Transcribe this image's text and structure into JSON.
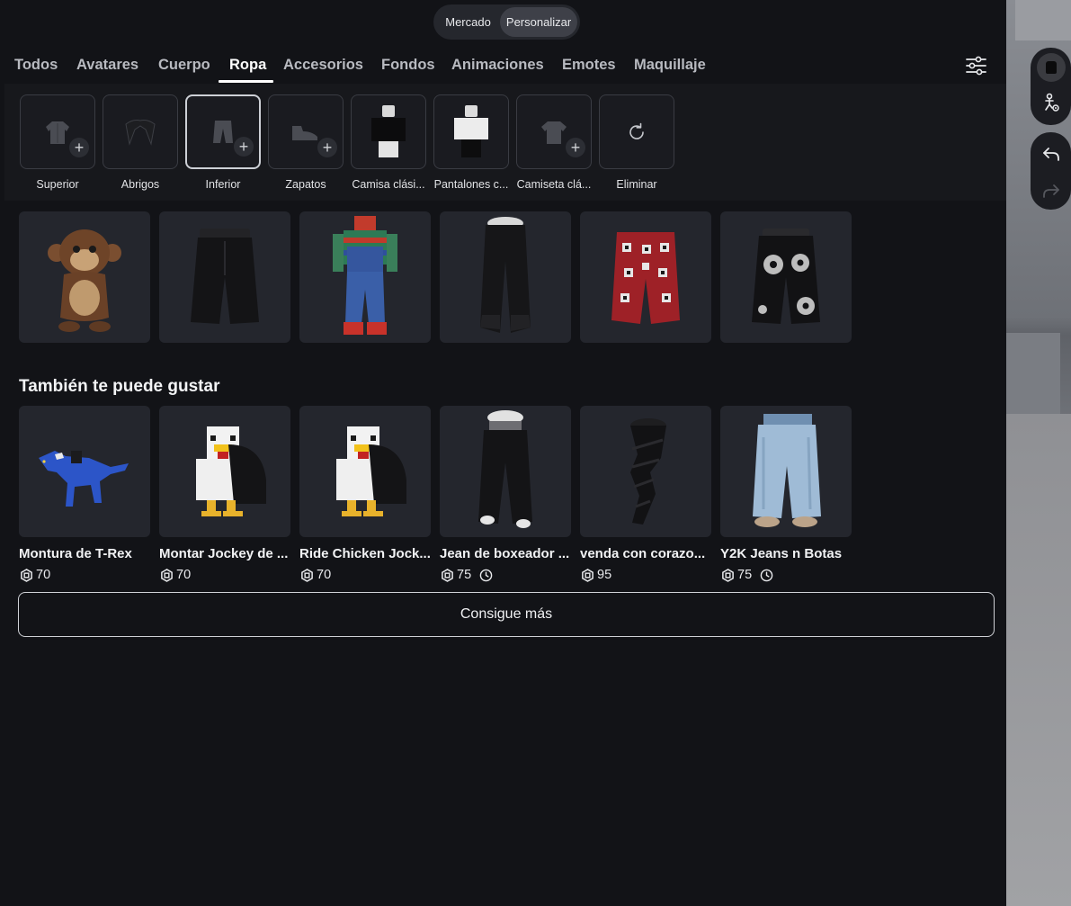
{
  "segmented": {
    "market": "Mercado",
    "customize": "Personalizar"
  },
  "tabs": [
    "Todos",
    "Avatares",
    "Cuerpo",
    "Ropa",
    "Accesorios",
    "Fondos",
    "Animaciones",
    "Emotes",
    "Maquillaje"
  ],
  "active_tab": "Ropa",
  "slots": [
    {
      "label": "Superior",
      "icon": "shirt-icon",
      "empty": true
    },
    {
      "label": "Abrigos",
      "icon": "jacket-icon",
      "empty": false
    },
    {
      "label": "Inferior",
      "icon": "pants-icon",
      "empty": true,
      "selected": true
    },
    {
      "label": "Zapatos",
      "icon": "shoe-icon",
      "empty": true
    },
    {
      "label": "Camisa clási...",
      "icon": "classic-shirt-thumbnail",
      "empty": false
    },
    {
      "label": "Pantalones c...",
      "icon": "classic-pants-thumbnail",
      "empty": false
    },
    {
      "label": "Camiseta clá...",
      "icon": "tshirt-icon",
      "empty": true
    },
    {
      "label": "Eliminar",
      "icon": "reset-icon",
      "empty": false
    }
  ],
  "owned_items": [
    {
      "thumbnail": "monkey-costume"
    },
    {
      "thumbnail": "black-shorts"
    },
    {
      "thumbnail": "doll-overalls"
    },
    {
      "thumbnail": "black-baggy-pants"
    },
    {
      "thumbnail": "red-pattern-shorts"
    },
    {
      "thumbnail": "black-floral-shorts"
    }
  ],
  "recommendations": {
    "title": "También te puede gustar",
    "items": [
      {
        "name": "Montura de T-Rex",
        "price": "70",
        "limited": false,
        "thumbnail": "blue-trex"
      },
      {
        "name": "Montar Jockey de ...",
        "price": "70",
        "limited": false,
        "thumbnail": "chicken-jockey"
      },
      {
        "name": "Ride Chicken Jock...",
        "price": "70",
        "limited": false,
        "thumbnail": "chicken-jockey"
      },
      {
        "name": "Jean de boxeador ...",
        "price": "75",
        "limited": true,
        "thumbnail": "boxer-jeans"
      },
      {
        "name": "venda con corazo...",
        "price": "95",
        "limited": false,
        "thumbnail": "black-wrap-leg"
      },
      {
        "name": "Y2K Jeans n Botas",
        "price": "75",
        "limited": true,
        "thumbnail": "y2k-jeans"
      }
    ]
  },
  "more_button": "Consigue más",
  "colors": {
    "background": "#121317",
    "card": "#24262d",
    "accent": "#ffffff"
  }
}
